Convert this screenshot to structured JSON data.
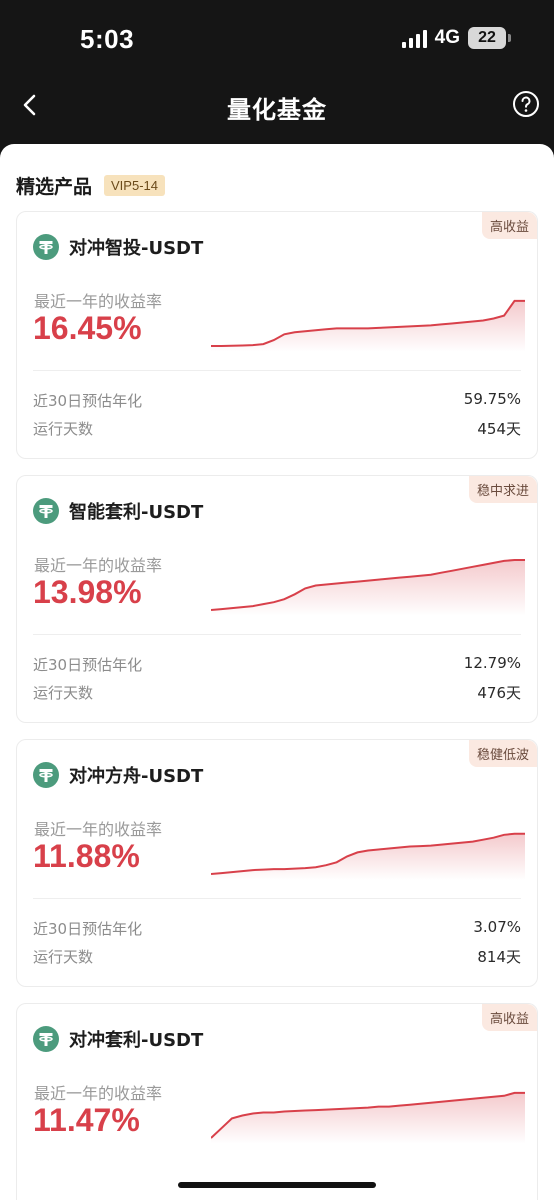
{
  "status": {
    "time": "5:03",
    "network": "4G",
    "battery": "22"
  },
  "nav": {
    "title": "量化基金"
  },
  "section": {
    "title": "精选产品",
    "badge": "VIP5-14"
  },
  "common": {
    "return_label": "最近一年的收益率",
    "stat1_label": "近30日预估年化",
    "stat2_label": "运行天数"
  },
  "colors": {
    "accent_red": "#d8404a",
    "tether_green": "#4c9b7d",
    "tag_bg": "#fbe9e1"
  },
  "products": [
    {
      "name": "对冲智投-USDT",
      "tag": "高收益",
      "return": "16.45%",
      "apy30": "59.75%",
      "days": "454天",
      "trend": [
        2,
        2,
        2.2,
        2.5,
        3,
        4,
        8,
        14,
        16,
        17,
        18,
        19,
        20,
        20,
        20,
        20,
        20.5,
        21,
        21.5,
        22,
        22.5,
        23,
        24,
        25,
        26,
        27,
        28,
        30,
        33,
        48,
        48
      ]
    },
    {
      "name": "智能套利-USDT",
      "tag": "稳中求进",
      "return": "13.98%",
      "apy30": "12.79%",
      "days": "476天",
      "trend": [
        2,
        3,
        4,
        5,
        6,
        8,
        10,
        13,
        18,
        24,
        27,
        28,
        29,
        30,
        31,
        32,
        33,
        34,
        35,
        36,
        37,
        38,
        40,
        42,
        44,
        46,
        48,
        50,
        52,
        53,
        53
      ]
    },
    {
      "name": "对冲方舟-USDT",
      "tag": "稳健低波",
      "return": "11.88%",
      "apy30": "3.07%",
      "days": "814天",
      "trend": [
        2,
        3,
        4,
        5,
        6,
        6.5,
        7,
        7,
        7.5,
        8,
        9,
        11,
        14,
        20,
        24,
        26,
        27,
        28,
        29,
        30,
        30.5,
        31,
        32,
        33,
        34,
        35,
        37,
        39,
        42,
        43,
        43
      ]
    },
    {
      "name": "对冲套利-USDT",
      "tag": "高收益",
      "return": "11.47%",
      "trend": [
        2,
        12,
        22,
        25,
        27,
        28,
        28,
        29,
        29.5,
        30,
        30.5,
        31,
        31.5,
        32,
        32.5,
        33,
        34,
        34,
        35,
        36,
        37,
        38,
        39,
        40,
        41,
        42,
        43,
        44,
        45,
        48,
        48
      ]
    }
  ]
}
